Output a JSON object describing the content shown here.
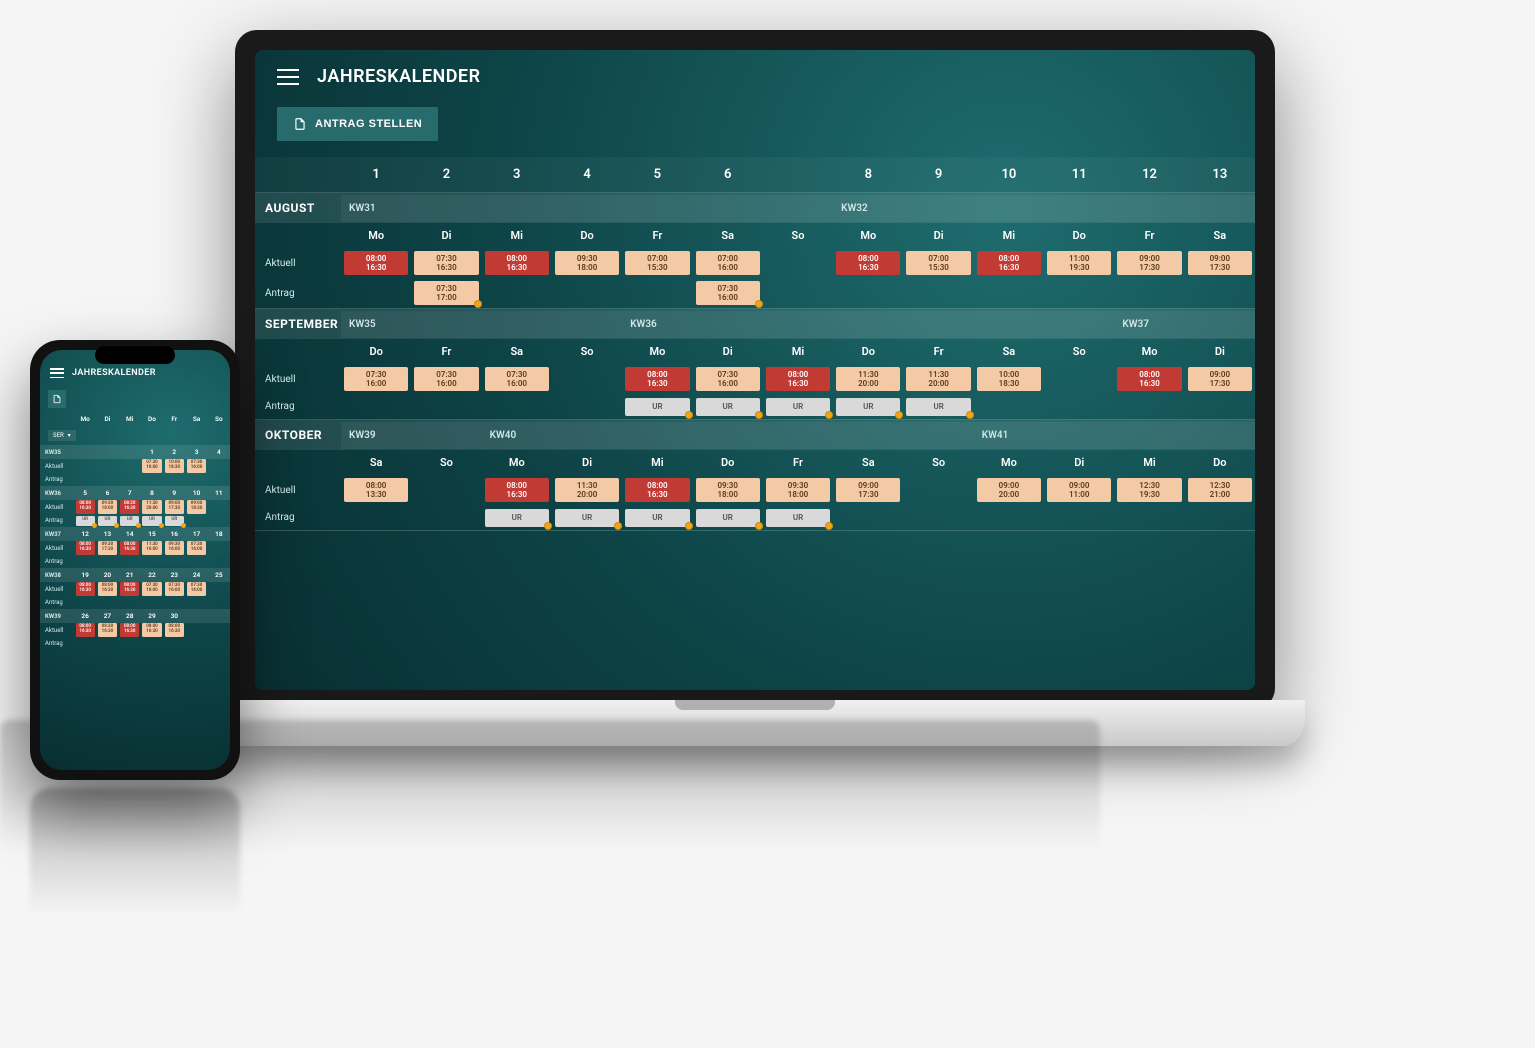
{
  "app": {
    "title": "JAHRESKALENDER",
    "submit_btn": "ANTRAG STELLEN",
    "row_labels": {
      "aktuell": "Aktuell",
      "antrag": "Antrag"
    },
    "day_numbers": [
      "1",
      "2",
      "3",
      "4",
      "5",
      "6",
      "",
      "8",
      "9",
      "10",
      "11",
      "12",
      "13"
    ],
    "sections": [
      {
        "month": "AUGUST",
        "weeks": [
          {
            "label": "KW31",
            "span": 7,
            "col": 2
          },
          {
            "label": "KW32",
            "span": 6,
            "col": 9
          }
        ],
        "days": [
          "Mo",
          "Di",
          "Mi",
          "Do",
          "Fr",
          "Sa",
          "So",
          "Mo",
          "Di",
          "Mi",
          "Do",
          "Fr",
          "Sa"
        ],
        "aktuell": [
          {
            "t1": "08:00",
            "t2": "16:30",
            "v": "red"
          },
          {
            "t1": "07:30",
            "t2": "16:30",
            "v": "tan"
          },
          {
            "t1": "08:00",
            "t2": "16:30",
            "v": "red"
          },
          {
            "t1": "09:30",
            "t2": "18:00",
            "v": "tan"
          },
          {
            "t1": "07:00",
            "t2": "15:30",
            "v": "tan"
          },
          {
            "t1": "07:00",
            "t2": "16:00",
            "v": "tan"
          },
          null,
          {
            "t1": "08:00",
            "t2": "16:30",
            "v": "red"
          },
          {
            "t1": "07:00",
            "t2": "15:30",
            "v": "tan"
          },
          {
            "t1": "08:00",
            "t2": "16:30",
            "v": "red"
          },
          {
            "t1": "11:00",
            "t2": "19:30",
            "v": "tan"
          },
          {
            "t1": "09:00",
            "t2": "17:30",
            "v": "tan"
          },
          {
            "t1": "09:00",
            "t2": "17:30",
            "v": "tan"
          }
        ],
        "antrag": [
          null,
          {
            "t1": "07:30",
            "t2": "17:00",
            "v": "tan",
            "dot": true
          },
          null,
          null,
          null,
          {
            "t1": "07:30",
            "t2": "16:00",
            "v": "tan",
            "dot": true
          },
          null,
          null,
          null,
          null,
          null,
          null,
          null
        ]
      },
      {
        "month": "SEPTEMBER",
        "weeks": [
          {
            "label": "KW35",
            "span": 4,
            "col": 2
          },
          {
            "label": "KW36",
            "span": 7,
            "col": 6
          },
          {
            "label": "KW37",
            "span": 2,
            "col": 13
          }
        ],
        "days": [
          "Do",
          "Fr",
          "Sa",
          "So",
          "Mo",
          "Di",
          "Mi",
          "Do",
          "Fr",
          "Sa",
          "So",
          "Mo",
          "Di"
        ],
        "aktuell": [
          {
            "t1": "07:30",
            "t2": "16:00",
            "v": "tan"
          },
          {
            "t1": "07:30",
            "t2": "16:00",
            "v": "tan"
          },
          {
            "t1": "07:30",
            "t2": "16:00",
            "v": "tan"
          },
          null,
          {
            "t1": "08:00",
            "t2": "16:30",
            "v": "red"
          },
          {
            "t1": "07:30",
            "t2": "16:00",
            "v": "tan"
          },
          {
            "t1": "08:00",
            "t2": "16:30",
            "v": "red"
          },
          {
            "t1": "11:30",
            "t2": "20:00",
            "v": "tan"
          },
          {
            "t1": "11:30",
            "t2": "20:00",
            "v": "tan"
          },
          {
            "t1": "10:00",
            "t2": "18:30",
            "v": "tan"
          },
          null,
          {
            "t1": "08:00",
            "t2": "16:30",
            "v": "red"
          },
          {
            "t1": "09:00",
            "t2": "17:30",
            "v": "tan"
          }
        ],
        "antrag": [
          null,
          null,
          null,
          null,
          {
            "t1": "UR",
            "v": "gray",
            "dot": true
          },
          {
            "t1": "UR",
            "v": "gray",
            "dot": true
          },
          {
            "t1": "UR",
            "v": "gray",
            "dot": true
          },
          {
            "t1": "UR",
            "v": "gray",
            "dot": true
          },
          {
            "t1": "UR",
            "v": "gray",
            "dot": true
          },
          null,
          null,
          null,
          null
        ]
      },
      {
        "month": "OKTOBER",
        "weeks": [
          {
            "label": "KW39",
            "span": 2,
            "col": 2
          },
          {
            "label": "KW40",
            "span": 7,
            "col": 4
          },
          {
            "label": "KW41",
            "span": 4,
            "col": 11
          }
        ],
        "days": [
          "Sa",
          "So",
          "Mo",
          "Di",
          "Mi",
          "Do",
          "Fr",
          "Sa",
          "So",
          "Mo",
          "Di",
          "Mi",
          "Do"
        ],
        "aktuell": [
          {
            "t1": "08:00",
            "t2": "13:30",
            "v": "tan"
          },
          null,
          {
            "t1": "08:00",
            "t2": "16:30",
            "v": "red"
          },
          {
            "t1": "11:30",
            "t2": "20:00",
            "v": "tan"
          },
          {
            "t1": "08:00",
            "t2": "16:30",
            "v": "red"
          },
          {
            "t1": "09:30",
            "t2": "18:00",
            "v": "tan"
          },
          {
            "t1": "09:30",
            "t2": "18:00",
            "v": "tan"
          },
          {
            "t1": "09:00",
            "t2": "17:30",
            "v": "tan"
          },
          null,
          {
            "t1": "09:00",
            "t2": "20:00",
            "v": "tan"
          },
          {
            "t1": "09:00",
            "t2": "11:00",
            "v": "tan"
          },
          {
            "t1": "12:30",
            "t2": "19:30",
            "v": "tan"
          },
          {
            "t1": "12:30",
            "t2": "21:00",
            "v": "tan"
          }
        ],
        "antrag": [
          null,
          null,
          {
            "t1": "UR",
            "v": "gray",
            "dot": true
          },
          {
            "t1": "UR",
            "v": "gray",
            "dot": true
          },
          {
            "t1": "UR",
            "v": "gray",
            "dot": true
          },
          {
            "t1": "UR",
            "v": "gray",
            "dot": true
          },
          {
            "t1": "UR",
            "v": "gray",
            "dot": true
          },
          null,
          null,
          null,
          null,
          null,
          null
        ]
      }
    ]
  },
  "phone": {
    "title": "JAHRESKALENDER",
    "selector": "SER",
    "days": [
      "Mo",
      "Di",
      "Mi",
      "Do",
      "Fr",
      "Sa",
      "So"
    ],
    "blocks": [
      {
        "kw": "KW35",
        "nums": [
          "",
          "",
          "",
          "1",
          "2",
          "3",
          "4"
        ],
        "aktuell": [
          null,
          null,
          null,
          {
            "t1": "07:30",
            "t2": "16:00",
            "v": "tan"
          },
          {
            "t1": "10:00",
            "t2": "18:30",
            "v": "tan"
          },
          {
            "t1": "07:30",
            "t2": "16:00",
            "v": "tan"
          },
          null
        ],
        "antrag": [
          null,
          null,
          null,
          null,
          null,
          null,
          null
        ]
      },
      {
        "kw": "KW36",
        "nums": [
          "5",
          "6",
          "7",
          "8",
          "9",
          "10",
          "11"
        ],
        "aktuell": [
          {
            "t1": "08:00",
            "t2": "16:30",
            "v": "red"
          },
          {
            "t1": "09:30",
            "t2": "18:00",
            "v": "tan"
          },
          {
            "t1": "08:20",
            "t2": "16:30",
            "v": "red"
          },
          {
            "t1": "11:30",
            "t2": "20:00",
            "v": "tan"
          },
          {
            "t1": "09:00",
            "t2": "17:30",
            "v": "tan"
          },
          {
            "t1": "09:00",
            "t2": "18:30",
            "v": "tan"
          },
          null
        ],
        "antrag": [
          {
            "t1": "UR",
            "v": "gray",
            "dot": true
          },
          {
            "t1": "UR",
            "v": "gray",
            "dot": true
          },
          {
            "t1": "UR",
            "v": "gray",
            "dot": true
          },
          {
            "t1": "UR",
            "v": "gray",
            "dot": true
          },
          {
            "t1": "UR",
            "v": "gray",
            "dot": true
          },
          null,
          null
        ]
      },
      {
        "kw": "KW37",
        "nums": [
          "12",
          "13",
          "14",
          "15",
          "16",
          "17",
          "18"
        ],
        "aktuell": [
          {
            "t1": "08:00",
            "t2": "16:30",
            "v": "red"
          },
          {
            "t1": "09:30",
            "t2": "17:30",
            "v": "tan"
          },
          {
            "t1": "08:00",
            "t2": "16:30",
            "v": "red"
          },
          {
            "t1": "11:30",
            "t2": "16:00",
            "v": "tan"
          },
          {
            "t1": "09:30",
            "t2": "16:00",
            "v": "tan"
          },
          {
            "t1": "07:30",
            "t2": "16:00",
            "v": "tan"
          },
          null
        ],
        "antrag": [
          null,
          null,
          null,
          null,
          null,
          null,
          null
        ]
      },
      {
        "kw": "KW38",
        "nums": [
          "19",
          "20",
          "21",
          "22",
          "23",
          "24",
          "25"
        ],
        "aktuell": [
          {
            "t1": "08:00",
            "t2": "16:30",
            "v": "red"
          },
          {
            "t1": "08:00",
            "t2": "16:30",
            "v": "tan"
          },
          {
            "t1": "08:00",
            "t2": "16:30",
            "v": "red"
          },
          {
            "t1": "07:30",
            "t2": "16:00",
            "v": "tan"
          },
          {
            "t1": "07:30",
            "t2": "16:00",
            "v": "tan"
          },
          {
            "t1": "07:30",
            "t2": "16:00",
            "v": "tan"
          },
          null
        ],
        "antrag": [
          null,
          null,
          null,
          null,
          null,
          null,
          null
        ]
      },
      {
        "kw": "KW39",
        "nums": [
          "26",
          "27",
          "28",
          "29",
          "30",
          "",
          ""
        ],
        "aktuell": [
          {
            "t1": "08:00",
            "t2": "16:30",
            "v": "red"
          },
          {
            "t1": "08:30",
            "t2": "16:30",
            "v": "tan"
          },
          {
            "t1": "08:00",
            "t2": "16:30",
            "v": "red"
          },
          {
            "t1": "08:00",
            "t2": "16:30",
            "v": "tan"
          },
          {
            "t1": "08:00",
            "t2": "16:30",
            "v": "tan"
          },
          null,
          null
        ],
        "antrag": [
          null,
          null,
          null,
          null,
          null,
          null,
          null
        ]
      }
    ]
  }
}
